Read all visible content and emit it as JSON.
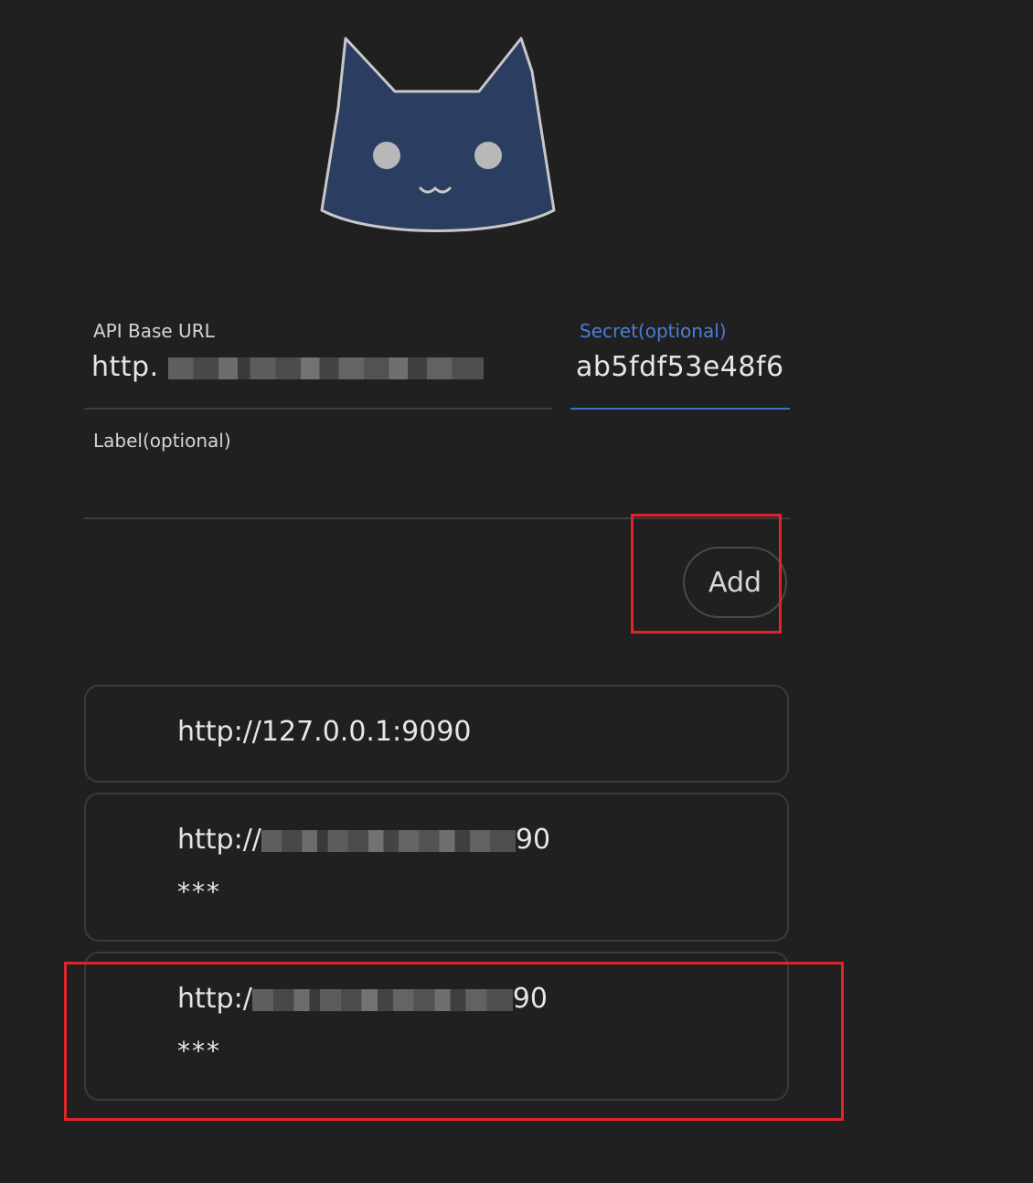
{
  "logo": {
    "icon": "cat-face-icon",
    "face_color": "#2b3d60",
    "outline_color": "#c8c8c8"
  },
  "form": {
    "api_base_url": {
      "label": "API Base URL",
      "value_visible": "http",
      "value_tail": ".",
      "value_obscured": true
    },
    "secret": {
      "label": "Secret(optional)",
      "value": "ab5fdf53e48f6",
      "focused": true
    },
    "label_field": {
      "label": "Label(optional)",
      "value": ""
    },
    "add_label": "Add"
  },
  "backends": [
    {
      "url": "http://127.0.0.1:9090",
      "url_obscured": false,
      "secret": ""
    },
    {
      "url_prefix": "http://",
      "url_suffix": "90",
      "url_obscured": true,
      "secret": "***"
    },
    {
      "url_prefix": "http:/",
      "url_suffix": "90",
      "url_obscured": true,
      "secret": "***"
    }
  ],
  "colors": {
    "background": "#202020",
    "accent": "#3f73c8",
    "highlight": "#e0242b"
  }
}
